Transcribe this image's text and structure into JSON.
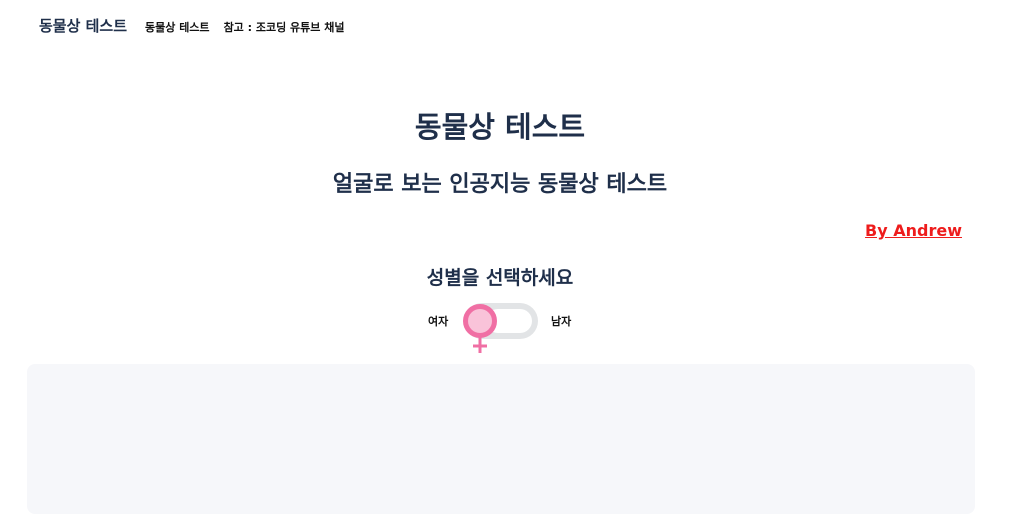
{
  "navbar": {
    "brand": "동물상 테스트",
    "links": [
      "동물상 테스트",
      "참고 : 조코딩 유튜브 채널"
    ]
  },
  "main": {
    "title": "동물상 테스트",
    "subtitle": "얼굴로 보는 인공지능 동물상 테스트",
    "author": "By Andrew",
    "gender_prompt": "성별을 선택하세요",
    "gender_toggle": {
      "left_label": "여자",
      "right_label": "남자",
      "selected": "여자",
      "knob_icon": "female-symbol"
    }
  },
  "colors": {
    "text": "#1f2f4a",
    "author": "#ee1c1c",
    "female_accent": "#f06fa4",
    "track": "#e2e4e6",
    "panel": "#f6f7fa"
  }
}
